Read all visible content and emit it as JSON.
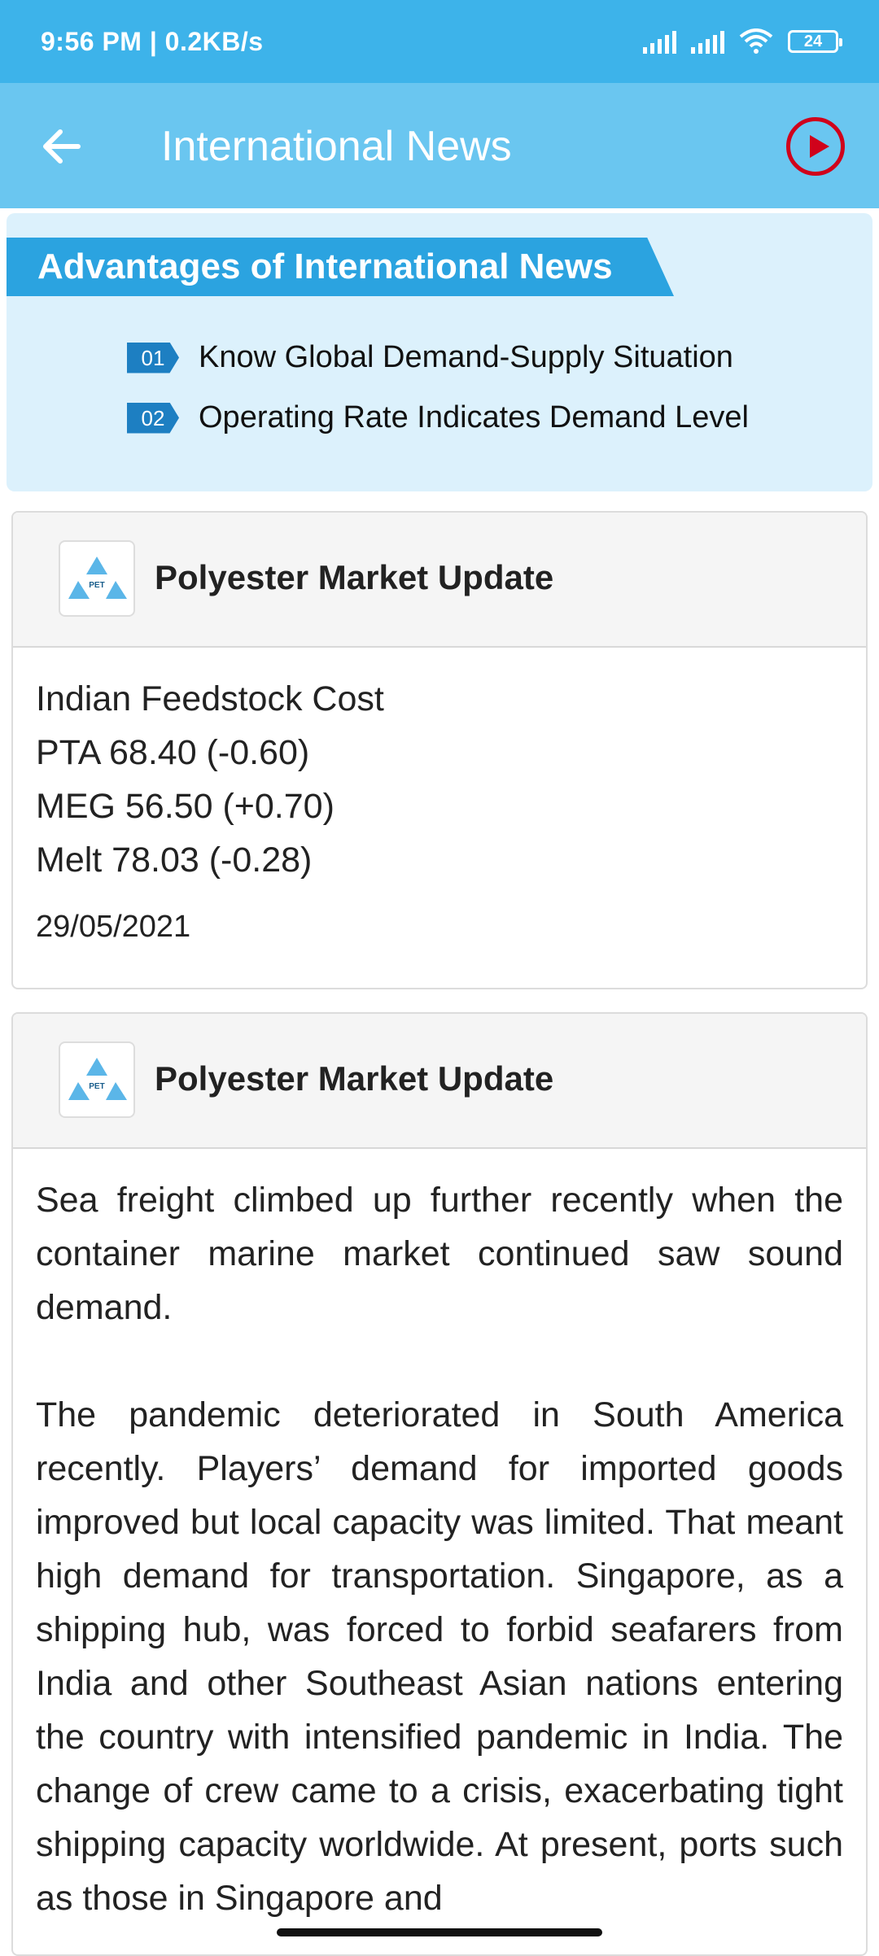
{
  "status_bar": {
    "time_speed": "9:56 PM | 0.2KB/s",
    "battery": "24"
  },
  "app_bar": {
    "back_icon": "arrow-left-icon",
    "title": "International News",
    "play_icon": "play-circle-icon",
    "accent_color": "#d0021b"
  },
  "banner": {
    "title": "Advantages of International News",
    "items": [
      {
        "num": "01",
        "text": "Know Global Demand-Supply Situation"
      },
      {
        "num": "02",
        "text": "Operating Rate Indicates Demand Level"
      }
    ]
  },
  "cards": [
    {
      "title": "Polyester Market Update",
      "lines": [
        "Indian Feedstock Cost",
        "PTA 68.40 (-0.60)",
        "MEG 56.50 (+0.70)",
        "Melt 78.03 (-0.28)"
      ],
      "date": "29/05/2021"
    },
    {
      "title": "Polyester Market Update",
      "paragraphs": [
        "Sea freight climbed up further recently when the container marine market continued saw sound demand.",
        "The pandemic deteriorated in South America recently. Players’ demand for imported goods improved but local capacity was limited. That meant high demand for transportation. Singapore, as a shipping hub, was forced to forbid seafarers from India and other Southeast Asian nations entering the country with intensified pandemic in India. The change of crew came to a crisis, exacerbating tight shipping capacity worldwide. At present, ports such as those in Singapore and"
      ]
    }
  ]
}
